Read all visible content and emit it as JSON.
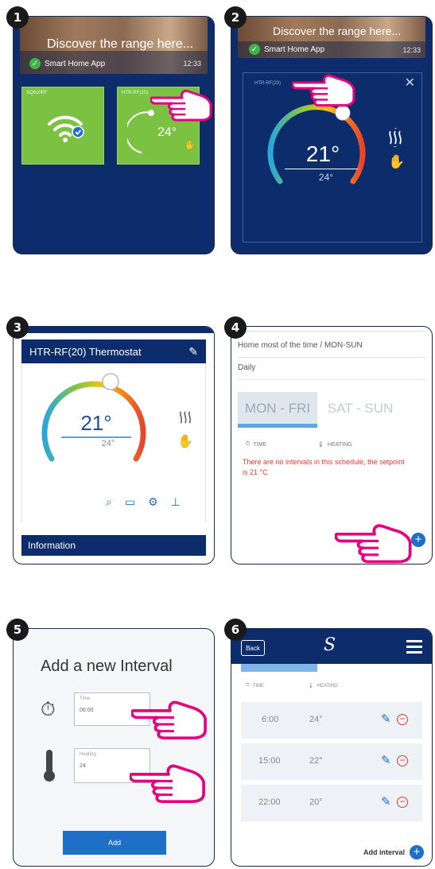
{
  "steps": [
    "1",
    "2",
    "3",
    "4",
    "5",
    "6"
  ],
  "banner": {
    "title": "Discover the range here...",
    "title_short": "Discover the range here",
    "app": "Smart Home App",
    "time": "12:33"
  },
  "tiles": {
    "wifi_label": "SQ610RF",
    "thermo_label": "HTR-RF(20)",
    "thermo_temp": "24°"
  },
  "popup": {
    "label": "HTR-RF(20)",
    "current": "21°",
    "setpoint": "24°"
  },
  "thermostat": {
    "title": "HTR-RF(20) Thermostat",
    "current": "21°",
    "setpoint": "24°",
    "info_label": "Information"
  },
  "schedule": {
    "header_row": "Home most of the time / MON-SUN",
    "type": "Daily",
    "tab_weekdays": "MON - FRI",
    "tab_weekend": "SAT - SUN",
    "col_time": "TIME",
    "col_heating": "HEATING",
    "empty_msg": "There are no intervals in this schedule, the setpoint is 21 °C"
  },
  "interval_form": {
    "title": "Add a new Interval",
    "time_label": "Time",
    "time_value": "06:00",
    "heating_label": "Heating",
    "heating_value": "24",
    "add_label": "Add"
  },
  "intervals": {
    "back_label": "Back",
    "logo_glyph": "S",
    "col_time": "TIME",
    "col_heating": "HEATING",
    "rows": [
      {
        "time": "6:00",
        "temp": "24°"
      },
      {
        "time": "15:00",
        "temp": "22°"
      },
      {
        "time": "22:00",
        "temp": "20°"
      }
    ],
    "add_interval_label": "Add interval"
  },
  "colors": {
    "navy": "#0c2c6c",
    "green": "#7cc242",
    "magenta": "#e5007e",
    "accent_blue": "#1e6fc8",
    "error_red": "#e53935"
  }
}
